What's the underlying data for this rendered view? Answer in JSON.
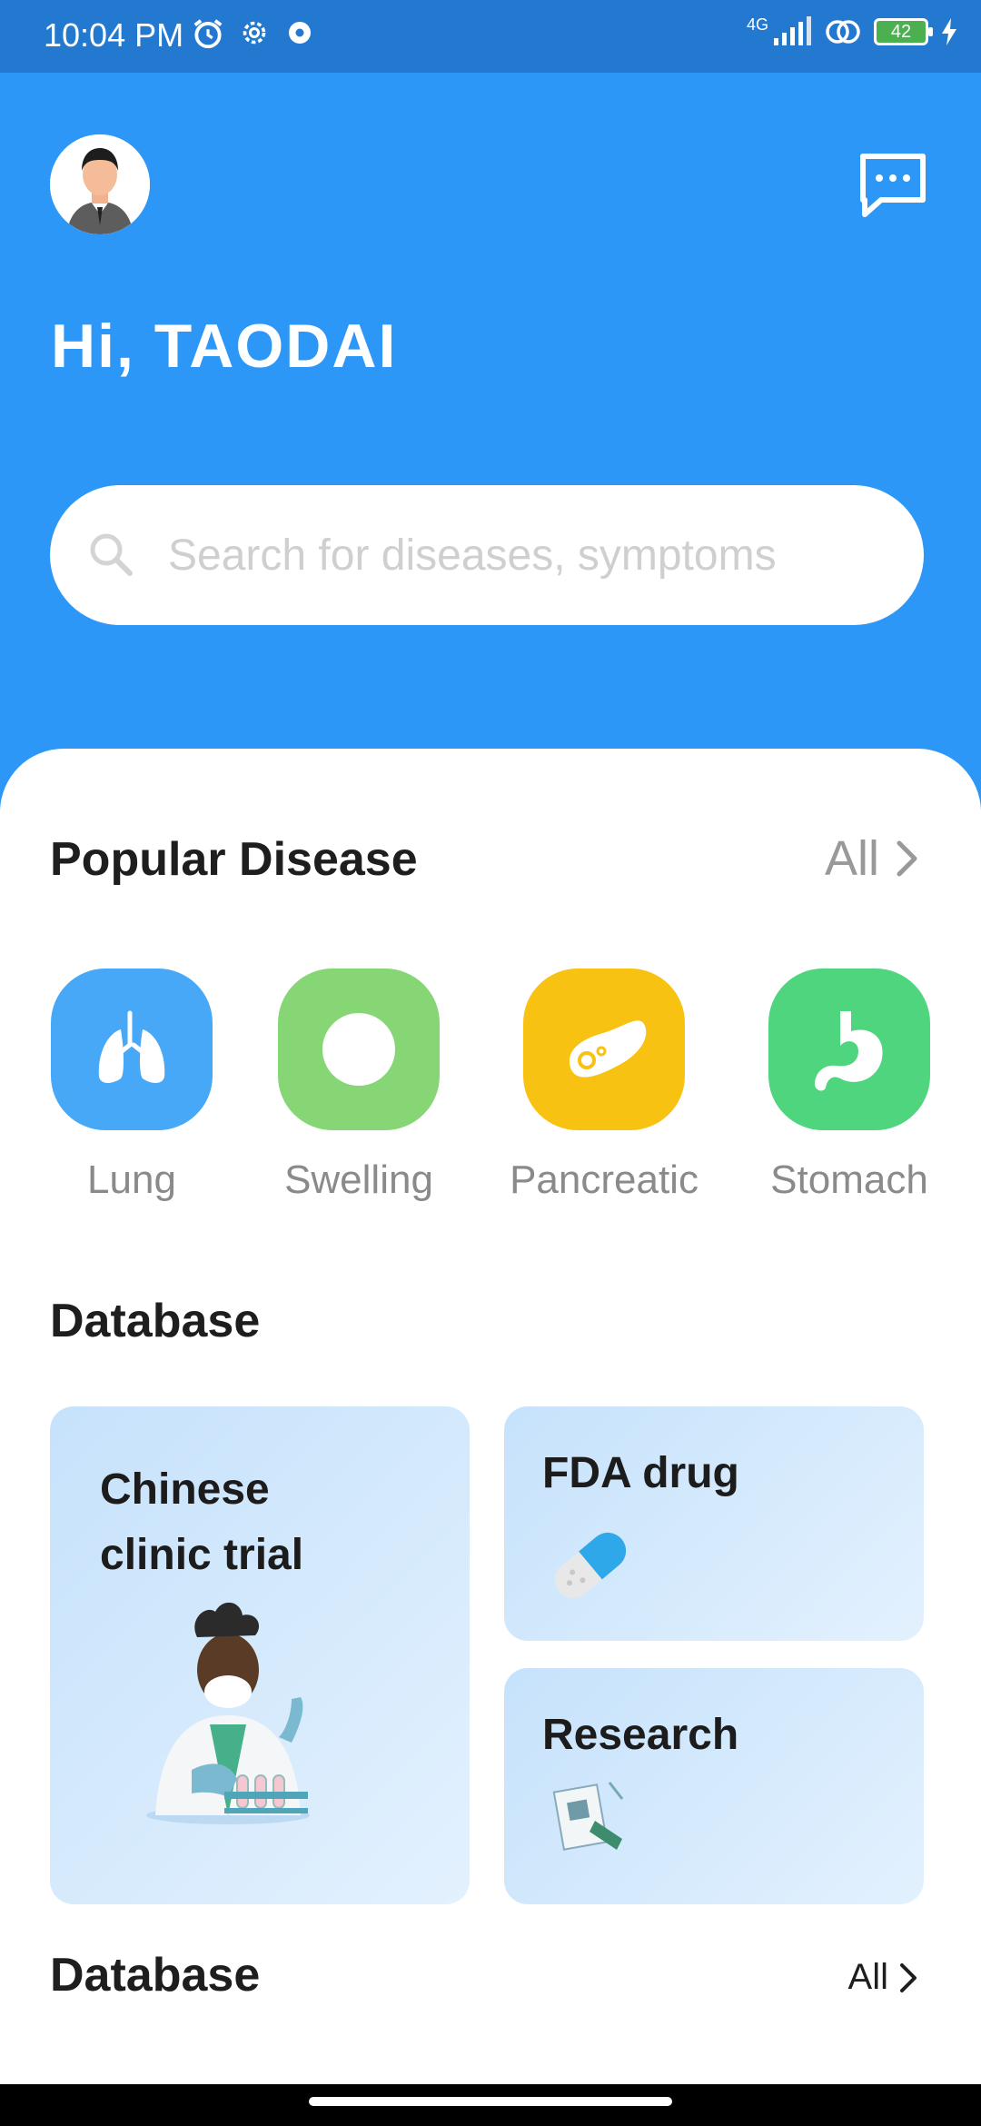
{
  "status_bar": {
    "time": "10:04 PM",
    "network": "4G",
    "battery": "42"
  },
  "header": {
    "greeting": "Hi, TAODAI",
    "search_placeholder": "Search for diseases, symptoms"
  },
  "popular": {
    "title": "Popular Disease",
    "all_label": "All",
    "items": [
      {
        "label": "Lung",
        "color": "#46A8F7"
      },
      {
        "label": "Swelling",
        "color": "#87D676"
      },
      {
        "label": "Pancreatic",
        "color": "#F8C213"
      },
      {
        "label": "Stomach",
        "color": "#4FD57E"
      }
    ]
  },
  "database": {
    "title": "Database",
    "cards": [
      {
        "title_line1": "Chinese",
        "title_line2": "clinic trial"
      },
      {
        "title": "FDA drug"
      },
      {
        "title": "Research"
      }
    ]
  },
  "database2": {
    "title": "Database",
    "all_label": "All"
  },
  "colors": {
    "header_bg": "#2D97F7",
    "status_bg": "#2279CF"
  }
}
